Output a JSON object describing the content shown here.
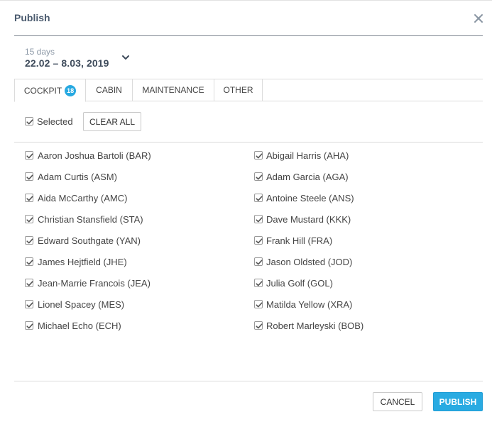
{
  "dialog": {
    "title": "Publish",
    "close_icon": "close-icon"
  },
  "date_range": {
    "duration": "15 days",
    "range": "22.02 – 8.03, 2019"
  },
  "tabs": [
    {
      "label": "COCKPIT",
      "badge": "18",
      "active": true
    },
    {
      "label": "CABIN"
    },
    {
      "label": "MAINTENANCE"
    },
    {
      "label": "OTHER"
    }
  ],
  "selection": {
    "selected_label": "Selected",
    "clear_all_label": "CLEAR ALL"
  },
  "crew": {
    "left": [
      "Aaron Joshua Bartoli (BAR)",
      "Adam Curtis (ASM)",
      "Aida McCarthy (AMC)",
      "Christian Stansfield (STA)",
      "Edward Southgate (YAN)",
      "James Hejtfield (JHE)",
      "Jean-Marrie Francois (JEA)",
      "Lionel Spacey (MES)",
      "Michael Echo (ECH)"
    ],
    "right": [
      "Abigail Harris (AHA)",
      "Adam Garcia (AGA)",
      "Antoine Steele (ANS)",
      "Dave Mustard (KKK)",
      "Frank Hill (FRA)",
      "Jason Oldsted (JOD)",
      "Julia Golf (GOL)",
      "Matilda Yellow (XRA)",
      "Robert Marleyski (BOB)"
    ]
  },
  "footer": {
    "cancel_label": "CANCEL",
    "publish_label": "PUBLISH"
  },
  "colors": {
    "accent": "#29abe2",
    "badge": "#27a9e1",
    "title": "#4a5a6e"
  }
}
